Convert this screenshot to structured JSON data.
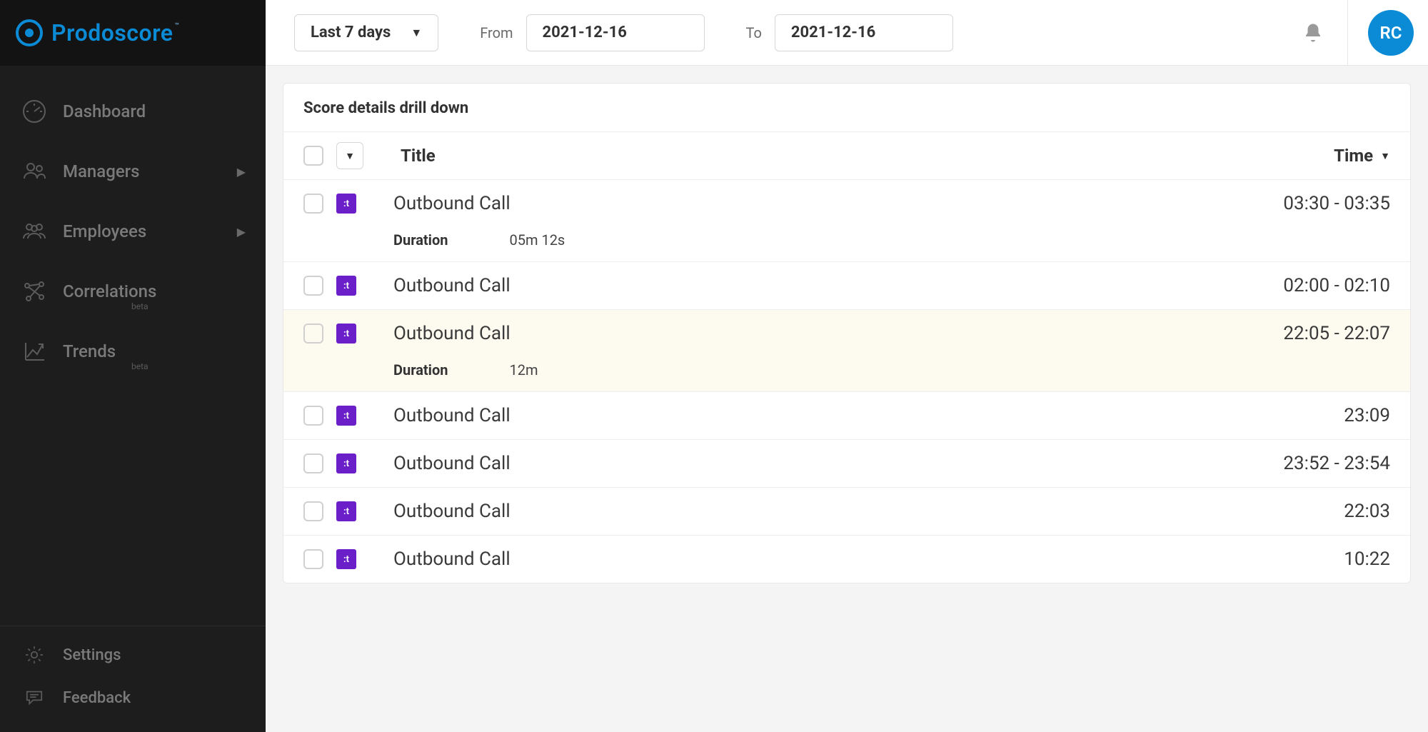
{
  "brand": "Prodoscore",
  "sidebar": {
    "items": [
      {
        "label": "Dashboard",
        "beta": "",
        "hasChevron": false
      },
      {
        "label": "Managers",
        "beta": "",
        "hasChevron": true
      },
      {
        "label": "Employees",
        "beta": "",
        "hasChevron": true
      },
      {
        "label": "Correlations",
        "beta": "beta",
        "hasChevron": false
      },
      {
        "label": "Trends",
        "beta": "beta",
        "hasChevron": false
      }
    ],
    "bottom": [
      {
        "label": "Settings"
      },
      {
        "label": "Feedback"
      }
    ]
  },
  "topbar": {
    "rangeLabel": "Last 7 days",
    "fromLabel": "From",
    "fromDate": "2021-12-16",
    "toLabel": "To",
    "toDate": "2021-12-16",
    "avatarInitials": "RC"
  },
  "panel": {
    "title": "Score details drill down",
    "columns": {
      "title": "Title",
      "time": "Time"
    },
    "detailLabels": {
      "duration": "Duration"
    },
    "rows": [
      {
        "title": "Outbound Call",
        "time": "03:30 - 03:35",
        "duration": "05m 12s",
        "expanded": true,
        "highlight": false
      },
      {
        "title": "Outbound Call",
        "time": "02:00 - 02:10",
        "duration": "",
        "expanded": false,
        "highlight": false
      },
      {
        "title": "Outbound Call",
        "time": "22:05 - 22:07",
        "duration": "12m",
        "expanded": true,
        "highlight": true
      },
      {
        "title": "Outbound Call",
        "time": "23:09",
        "duration": "",
        "expanded": false,
        "highlight": false
      },
      {
        "title": "Outbound Call",
        "time": "23:52 - 23:54",
        "duration": "",
        "expanded": false,
        "highlight": false
      },
      {
        "title": "Outbound Call",
        "time": "22:03",
        "duration": "",
        "expanded": false,
        "highlight": false
      },
      {
        "title": "Outbound Call",
        "time": "10:22",
        "duration": "",
        "expanded": false,
        "highlight": false
      }
    ]
  }
}
